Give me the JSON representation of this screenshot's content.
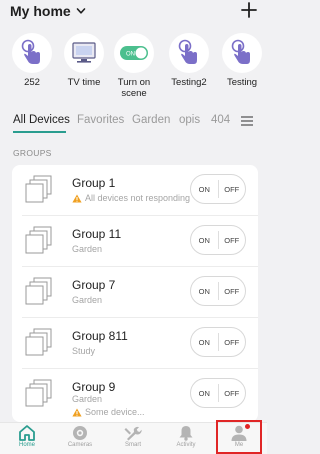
{
  "header": {
    "title": "My home",
    "add_icon": "plus-icon"
  },
  "scenes": [
    {
      "label": "252",
      "icon": "tap-hand-icon"
    },
    {
      "label": "TV time",
      "icon": "tv-icon"
    },
    {
      "label": "Turn on\nscene",
      "icon": "toggle-icon"
    },
    {
      "label": "Testing2",
      "icon": "tap-hand-icon"
    },
    {
      "label": "Testing",
      "icon": "tap-hand-icon"
    }
  ],
  "tabs": [
    "All Devices",
    "Favorites",
    "Garden",
    "opis",
    "404"
  ],
  "section": {
    "groups_heading": "GROUPS"
  },
  "groups": [
    {
      "name": "Group 1",
      "sub": "All devices not responding",
      "warning": true,
      "on": "ON",
      "off": "OFF"
    },
    {
      "name": "Group 11",
      "sub": "Garden",
      "warning": false,
      "on": "ON",
      "off": "OFF"
    },
    {
      "name": "Group 7",
      "sub": "Garden",
      "warning": false,
      "on": "ON",
      "off": "OFF"
    },
    {
      "name": "Group 811",
      "sub": "Study",
      "warning": false,
      "on": "ON",
      "off": "OFF"
    },
    {
      "name": "Group 9",
      "sub": "Garden",
      "sub2": "Some device...",
      "warning": true,
      "on": "ON",
      "off": "OFF"
    }
  ],
  "tabbar": {
    "items": [
      {
        "label": "Home",
        "icon": "home-icon",
        "active": true
      },
      {
        "label": "Cameras",
        "icon": "camera-icon",
        "active": false
      },
      {
        "label": "Smart",
        "icon": "wrench-icon",
        "active": false
      },
      {
        "label": "Activity",
        "icon": "bell-icon",
        "active": false
      },
      {
        "label": "Me",
        "icon": "person-icon",
        "active": false
      }
    ]
  },
  "colors": {
    "accent": "#2a9d8f",
    "scene_purple": "#7b6fc8",
    "warning": "#f0a020",
    "highlight_red": "#e02626"
  }
}
